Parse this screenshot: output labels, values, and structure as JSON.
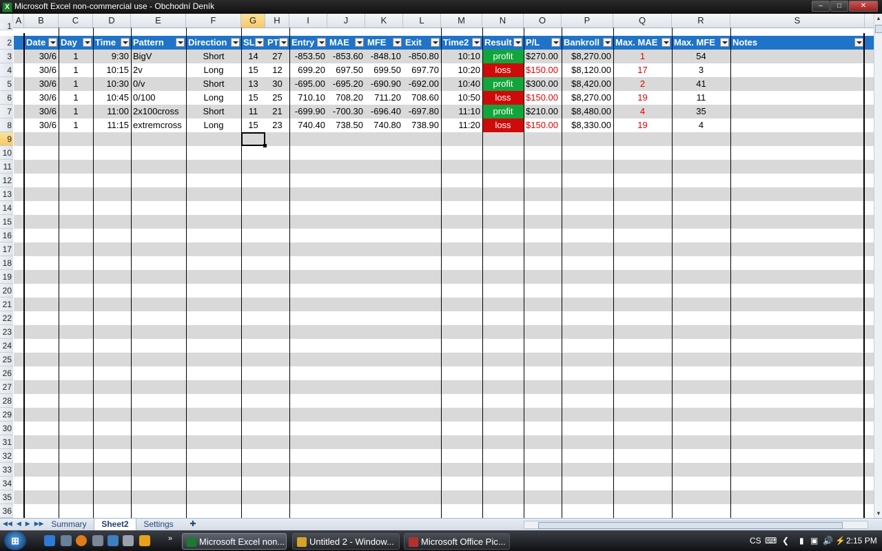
{
  "window": {
    "title": "Microsoft Excel non-commercial use - Obchodní Deník",
    "app_icon": "excel-icon"
  },
  "columns": [
    "A",
    "B",
    "C",
    "D",
    "E",
    "F",
    "G",
    "H",
    "I",
    "J",
    "K",
    "L",
    "M",
    "N",
    "O",
    "P",
    "Q",
    "R",
    "S"
  ],
  "active_column": "G",
  "active_row": "9",
  "row_numbers": [
    "1",
    "2",
    "3",
    "4",
    "5",
    "6",
    "7",
    "8",
    "9",
    "10",
    "11",
    "12",
    "13",
    "14",
    "15",
    "16",
    "17",
    "18",
    "19",
    "20",
    "21",
    "22",
    "23",
    "24",
    "25",
    "26",
    "27",
    "28",
    "29",
    "30",
    "31",
    "32",
    "33",
    "34",
    "35",
    "36"
  ],
  "table": {
    "headers": [
      "Date",
      "Day",
      "Time",
      "Pattern",
      "Direction",
      "SL",
      "PT",
      "Entry",
      "MAE",
      "MFE",
      "Exit",
      "Time2",
      "Result",
      "P/L",
      "Bankroll",
      "Max. MAE",
      "Max. MFE",
      "Notes"
    ],
    "rows": [
      [
        "30/6",
        "1",
        "9:30",
        "BigV",
        "Short",
        "14",
        "27",
        "-853.50",
        "-853.60",
        "-848.10",
        "-850.80",
        "10:10",
        "profit",
        "$270.00",
        "$8,270.00",
        "1",
        "54",
        ""
      ],
      [
        "30/6",
        "1",
        "10:15",
        "2v",
        "Long",
        "15",
        "12",
        "699.20",
        "697.50",
        "699.50",
        "697.70",
        "10:20",
        "loss",
        "$150.00",
        "$8,120.00",
        "17",
        "3",
        ""
      ],
      [
        "30/6",
        "1",
        "10:30",
        "0/v",
        "Short",
        "13",
        "30",
        "-695.00",
        "-695.20",
        "-690.90",
        "-692.00",
        "10:40",
        "profit",
        "$300.00",
        "$8,420.00",
        "2",
        "41",
        ""
      ],
      [
        "30/6",
        "1",
        "10:45",
        "0/100",
        "Long",
        "15",
        "25",
        "710.10",
        "708.20",
        "711.20",
        "708.60",
        "10:50",
        "loss",
        "$150.00",
        "$8,270.00",
        "19",
        "11",
        ""
      ],
      [
        "30/6",
        "1",
        "11:00",
        "2x100cross",
        "Short",
        "11",
        "21",
        "-699.90",
        "-700.30",
        "-696.40",
        "-697.80",
        "11:10",
        "profit",
        "$210.00",
        "$8,480.00",
        "4",
        "35",
        ""
      ],
      [
        "30/6",
        "1",
        "11:15",
        "extremcross",
        "Long",
        "15",
        "23",
        "740.40",
        "738.50",
        "740.80",
        "738.90",
        "11:20",
        "loss",
        "$150.00",
        "$8,330.00",
        "19",
        "4",
        ""
      ]
    ]
  },
  "sheets": {
    "tabs": [
      "Summary",
      "Sheet2",
      "Settings"
    ],
    "active": "Sheet2"
  },
  "taskbar": {
    "buttons": [
      {
        "label": "Microsoft Excel non...",
        "icon": "excel-icon"
      },
      {
        "label": "Untitled 2 - Window...",
        "icon": "window-icon"
      },
      {
        "label": "Microsoft Office Pic...",
        "icon": "picture-manager-icon"
      }
    ],
    "language": "CS",
    "clock": "2:15 PM"
  },
  "colors": {
    "header_blue": "#1f74c9",
    "band_gray": "#d9d9d9",
    "profit_green": "#12a53b",
    "loss_red": "#cf0a0a",
    "negative_text": "#e00000"
  }
}
